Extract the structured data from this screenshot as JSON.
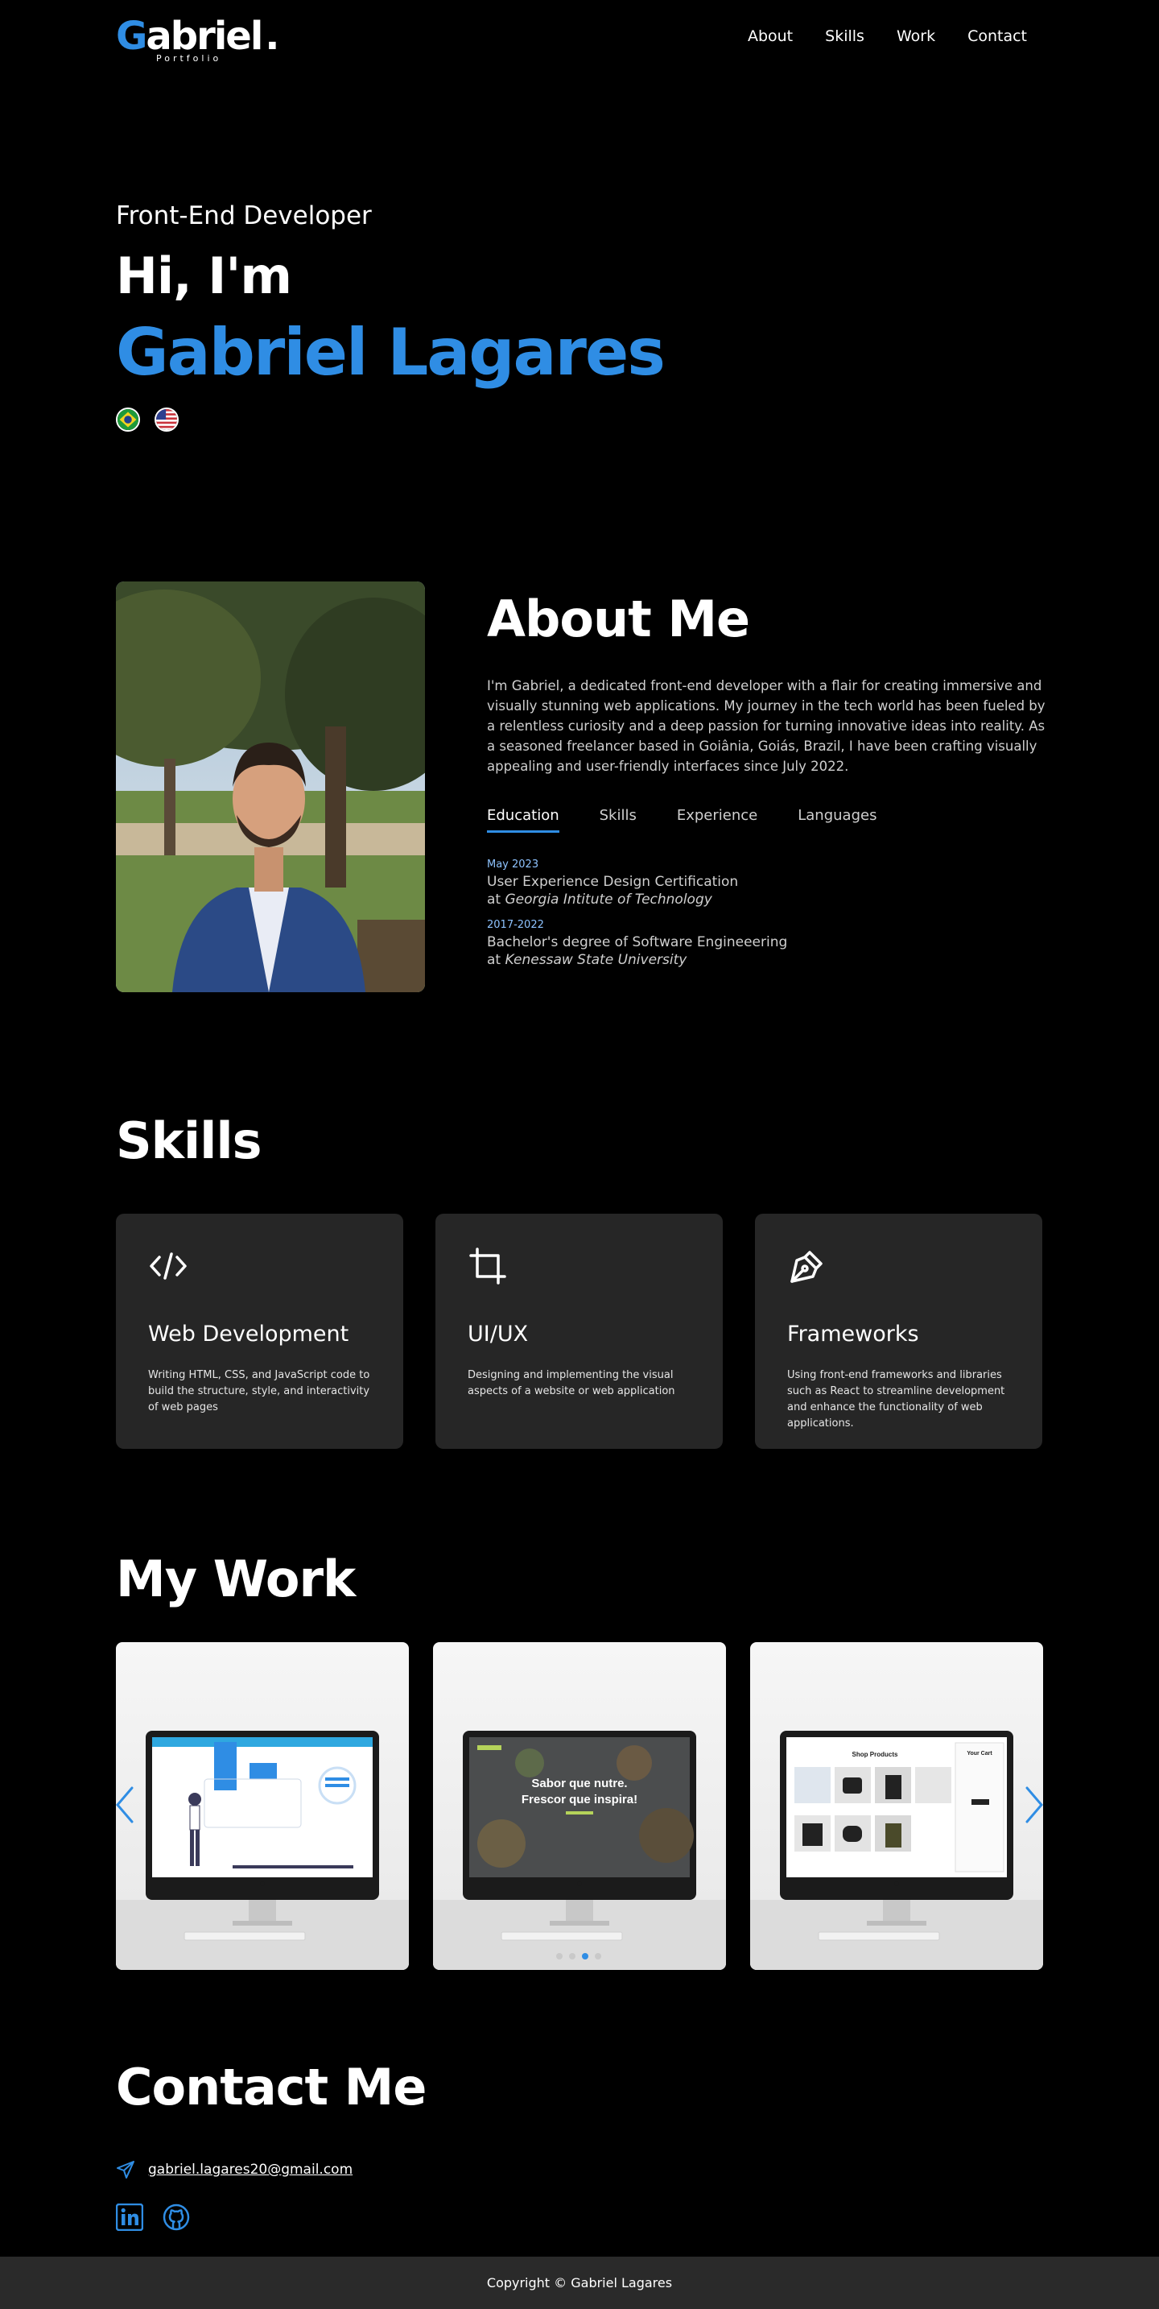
{
  "logo": {
    "first": "G",
    "rest": "abriel",
    "dot": ".",
    "subtitle": "Portfolio"
  },
  "nav": {
    "items": [
      "About",
      "Skills",
      "Work",
      "Contact"
    ]
  },
  "hero": {
    "role": "Front-End Developer",
    "greeting": "Hi, I'm",
    "name": "Gabriel Lagares",
    "flags": [
      "brazil-flag-icon",
      "usa-flag-icon"
    ]
  },
  "about": {
    "title": "About Me",
    "text": "I'm Gabriel, a dedicated front-end developer with a flair for creating immersive and visually stunning web applications. My journey in the tech world has been fueled by a relentless curiosity and a deep passion for turning innovative ideas into reality. As a seasoned freelancer based in Goiânia, Goiás, Brazil, I have been crafting visually appealing and user-friendly interfaces since July 2022.",
    "tabs": [
      "Education",
      "Skills",
      "Experience",
      "Languages"
    ],
    "active_tab": "Education",
    "education": [
      {
        "date": "May 2023",
        "title": "User Experience Design Certification",
        "at": "at",
        "place": "Georgia Intitute of Technology"
      },
      {
        "date": "2017-2022",
        "title": "Bachelor's degree of Software Engineeering",
        "at": "at",
        "place": "Kenessaw State University"
      }
    ]
  },
  "skills": {
    "title": "Skills",
    "cards": [
      {
        "icon": "code-icon",
        "title": "Web Development",
        "text": "Writing HTML, CSS, and JavaScript code to build the structure, style, and interactivity of web pages"
      },
      {
        "icon": "crop-icon",
        "title": "UI/UX",
        "text": "Designing and implementing the visual aspects of a website or web application"
      },
      {
        "icon": "pen-tool-icon",
        "title": "Frameworks",
        "text": "Using front-end frameworks and libraries such as React to streamline development and enhance the functionality of web applications."
      }
    ]
  },
  "work": {
    "title": "My Work",
    "slides": [
      {
        "screen_title": "",
        "screen_sub": ""
      },
      {
        "screen_title": "Sabor que nutre.",
        "screen_sub": "Frescor que inspira!"
      },
      {
        "screen_title": "Shop Products",
        "screen_sub": "Your Cart"
      }
    ],
    "dots_count": 4,
    "active_dot": 3,
    "accent": "#2f8de4"
  },
  "contact": {
    "title": "Contact Me",
    "email": "gabriel.lagares20@gmail.com",
    "socials": [
      "linkedin-icon",
      "github-icon"
    ]
  },
  "footer": {
    "text": "Copyright © Gabriel Lagares"
  },
  "colors": {
    "accent": "#2f8de4",
    "background": "#000000",
    "card": "#262626",
    "footer": "#2a2a2a"
  }
}
